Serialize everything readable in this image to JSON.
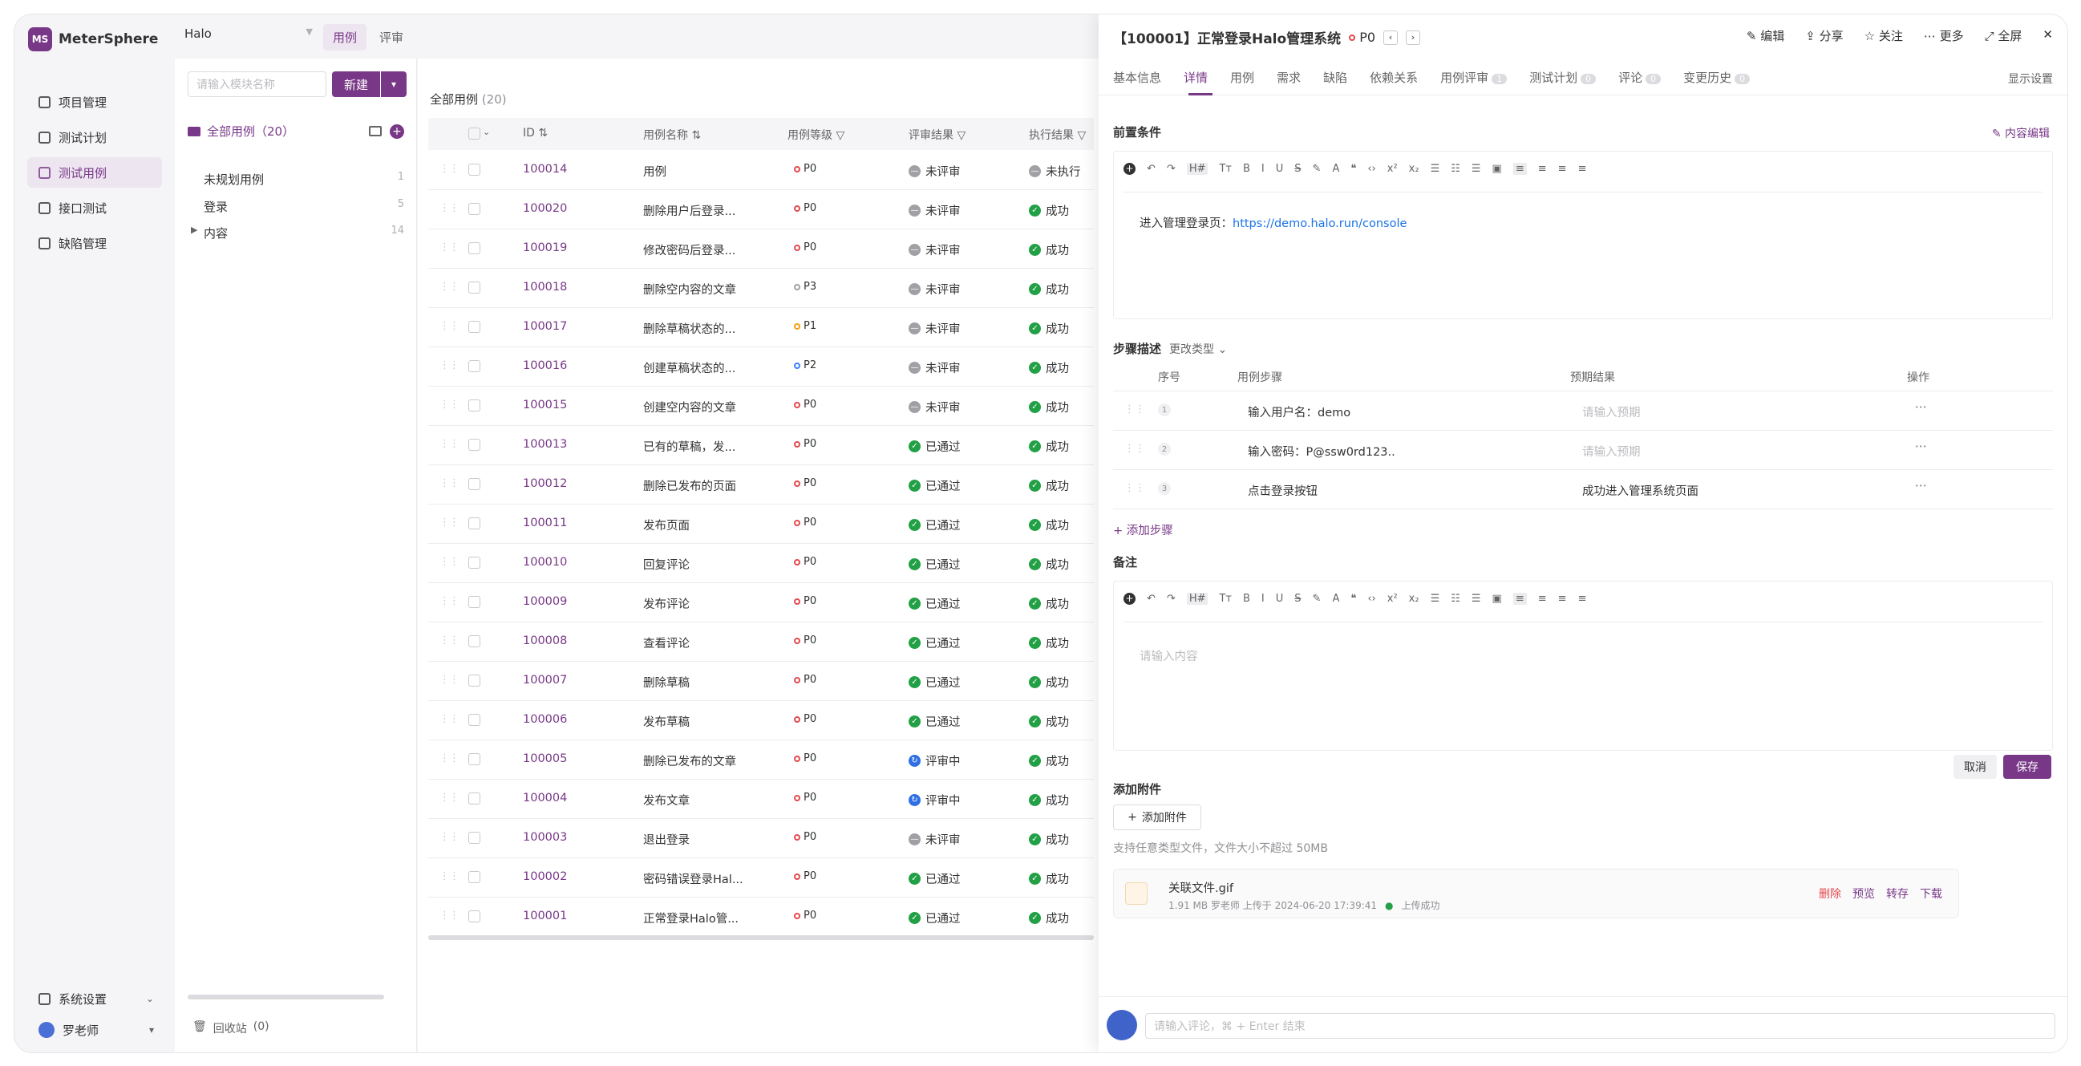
{
  "app": {
    "name": "MeterSphere",
    "logo_abbrev": "MS",
    "project": "Halo"
  },
  "top_tabs": [
    {
      "label": "用例",
      "active": true
    },
    {
      "label": "评审",
      "active": false
    }
  ],
  "nav": {
    "items": [
      {
        "label": "项目管理",
        "icon": "project-icon",
        "active": false
      },
      {
        "label": "测试计划",
        "icon": "plan-icon",
        "active": false
      },
      {
        "label": "测试用例",
        "icon": "case-icon",
        "active": true
      },
      {
        "label": "接口测试",
        "icon": "api-icon",
        "active": false
      },
      {
        "label": "缺陷管理",
        "icon": "bug-icon",
        "active": false
      }
    ],
    "settings_label": "系统设置",
    "user_name": "罗老师"
  },
  "tree": {
    "search_placeholder": "请输入模块名称",
    "new_label": "新建",
    "root_label": "全部用例（20）",
    "nodes": [
      {
        "label": "未规划用例",
        "count": "1"
      },
      {
        "label": "登录",
        "count": "5"
      },
      {
        "label": "内容",
        "count": "14"
      }
    ],
    "trash_label": "回收站",
    "trash_count": "(0)"
  },
  "table": {
    "breadcrumb": "全部用例",
    "breadcrumb_count": "(20)",
    "columns": [
      "ID",
      "用例名称",
      "用例等级",
      "评审结果",
      "执行结果"
    ],
    "rows": [
      {
        "id": "100014",
        "name": "用例",
        "level": "P0",
        "review": "未评审",
        "exec": "未执行"
      },
      {
        "id": "100020",
        "name": "删除用户后登录...",
        "level": "P0",
        "review": "未评审",
        "exec": "成功"
      },
      {
        "id": "100019",
        "name": "修改密码后登录...",
        "level": "P0",
        "review": "未评审",
        "exec": "成功"
      },
      {
        "id": "100018",
        "name": "删除空内容的文章",
        "level": "P3",
        "review": "未评审",
        "exec": "成功"
      },
      {
        "id": "100017",
        "name": "删除草稿状态的...",
        "level": "P1",
        "review": "未评审",
        "exec": "成功"
      },
      {
        "id": "100016",
        "name": "创建草稿状态的...",
        "level": "P2",
        "review": "未评审",
        "exec": "成功"
      },
      {
        "id": "100015",
        "name": "创建空内容的文章",
        "level": "P0",
        "review": "未评审",
        "exec": "成功"
      },
      {
        "id": "100013",
        "name": "已有的草稿，发...",
        "level": "P0",
        "review": "已通过",
        "exec": "成功"
      },
      {
        "id": "100012",
        "name": "删除已发布的页面",
        "level": "P0",
        "review": "已通过",
        "exec": "成功"
      },
      {
        "id": "100011",
        "name": "发布页面",
        "level": "P0",
        "review": "已通过",
        "exec": "成功"
      },
      {
        "id": "100010",
        "name": "回复评论",
        "level": "P0",
        "review": "已通过",
        "exec": "成功"
      },
      {
        "id": "100009",
        "name": "发布评论",
        "level": "P0",
        "review": "已通过",
        "exec": "成功"
      },
      {
        "id": "100008",
        "name": "查看评论",
        "level": "P0",
        "review": "已通过",
        "exec": "成功"
      },
      {
        "id": "100007",
        "name": "删除草稿",
        "level": "P0",
        "review": "已通过",
        "exec": "成功"
      },
      {
        "id": "100006",
        "name": "发布草稿",
        "level": "P0",
        "review": "已通过",
        "exec": "成功"
      },
      {
        "id": "100005",
        "name": "删除已发布的文章",
        "level": "P0",
        "review": "评审中",
        "exec": "成功"
      },
      {
        "id": "100004",
        "name": "发布文章",
        "level": "P0",
        "review": "评审中",
        "exec": "成功"
      },
      {
        "id": "100003",
        "name": "退出登录",
        "level": "P0",
        "review": "未评审",
        "exec": "成功"
      },
      {
        "id": "100002",
        "name": "密码错误登录Hal...",
        "level": "P0",
        "review": "已通过",
        "exec": "成功"
      },
      {
        "id": "100001",
        "name": "正常登录Halo管...",
        "level": "P0",
        "review": "已通过",
        "exec": "成功"
      }
    ]
  },
  "colors": {
    "accent": "#783887",
    "p0": "#e5484d",
    "p1": "#f59e0b",
    "p2": "#3b82f6",
    "p3": "#a0a0a5",
    "success": "#22a045",
    "pending": "#a0a0a5",
    "reviewing": "#2f6fe4"
  },
  "drawer": {
    "title": "【100001】正常登录Halo管理系统",
    "level": "P0",
    "actions": [
      "编辑",
      "分享",
      "关注",
      "更多",
      "全屏"
    ],
    "tabs": [
      {
        "label": "基本信息",
        "badge": ""
      },
      {
        "label": "详情",
        "badge": ""
      },
      {
        "label": "用例",
        "badge": ""
      },
      {
        "label": "需求",
        "badge": ""
      },
      {
        "label": "缺陷",
        "badge": ""
      },
      {
        "label": "依赖关系",
        "badge": ""
      },
      {
        "label": "用例评审",
        "badge": "1"
      },
      {
        "label": "测试计划",
        "badge": "0"
      },
      {
        "label": "评论",
        "badge": "0"
      },
      {
        "label": "变更历史",
        "badge": "0"
      }
    ],
    "display_settings": "显示设置",
    "precondition_label": "前置条件",
    "content_edit_label": "内容编辑",
    "precondition_text": "进入管理登录页：",
    "precondition_link": "https://demo.halo.run/console",
    "steps_label": "步骤描述",
    "change_type_label": "更改类型",
    "steps_columns": [
      "序号",
      "用例步骤",
      "预期结果",
      "操作"
    ],
    "steps": [
      {
        "no": "1",
        "step": "输入用户名：demo",
        "expected": "请输入预期",
        "expected_is_placeholder": true
      },
      {
        "no": "2",
        "step": "输入密码：P@ssw0rd123..",
        "expected": "请输入预期",
        "expected_is_placeholder": true
      },
      {
        "no": "3",
        "step": "点击登录按钮",
        "expected": "成功进入管理系统页面",
        "expected_is_placeholder": false
      }
    ],
    "add_step_label": "添加步骤",
    "remark_label": "备注",
    "remark_placeholder": "请输入内容",
    "cancel_label": "取消",
    "save_label": "保存",
    "attachment_label": "添加附件",
    "add_attachment_button": "添加附件",
    "attachment_tip": "支持任意类型文件，文件大小不超过 50MB",
    "attachment": {
      "name": "关联文件.gif",
      "meta": "1.91 MB  罗老师 上传于 2024-06-20 17:39:41",
      "status": "上传成功",
      "actions": [
        "删除",
        "预览",
        "转存",
        "下载"
      ]
    },
    "comment_placeholder": "请输入评论，⌘ + Enter 结束"
  }
}
